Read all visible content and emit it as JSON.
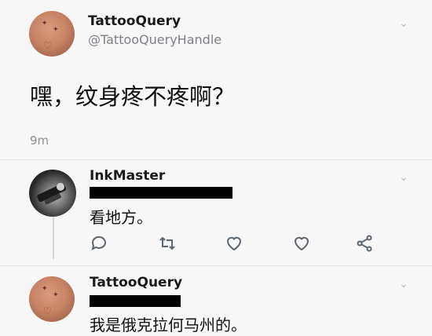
{
  "original_tweet": {
    "author_name": "TattooQuery",
    "author_handle": "@TattooQueryHandle",
    "text": "嘿，纹身疼不疼啊？",
    "timestamp": "9m"
  },
  "reply_1": {
    "author_name": "InkMaster",
    "text": "看地方。",
    "actions": [
      "reply-icon",
      "retweet-icon",
      "like-icon",
      "like-icon",
      "share-icon"
    ]
  },
  "reply_2": {
    "author_name": "TattooQuery",
    "text": "我是俄克拉何马州的。"
  },
  "colors": {
    "background": "#f7f7f7",
    "secondary_text": "#7d8186",
    "icon": "#5c6670",
    "redaction": "#000000"
  }
}
